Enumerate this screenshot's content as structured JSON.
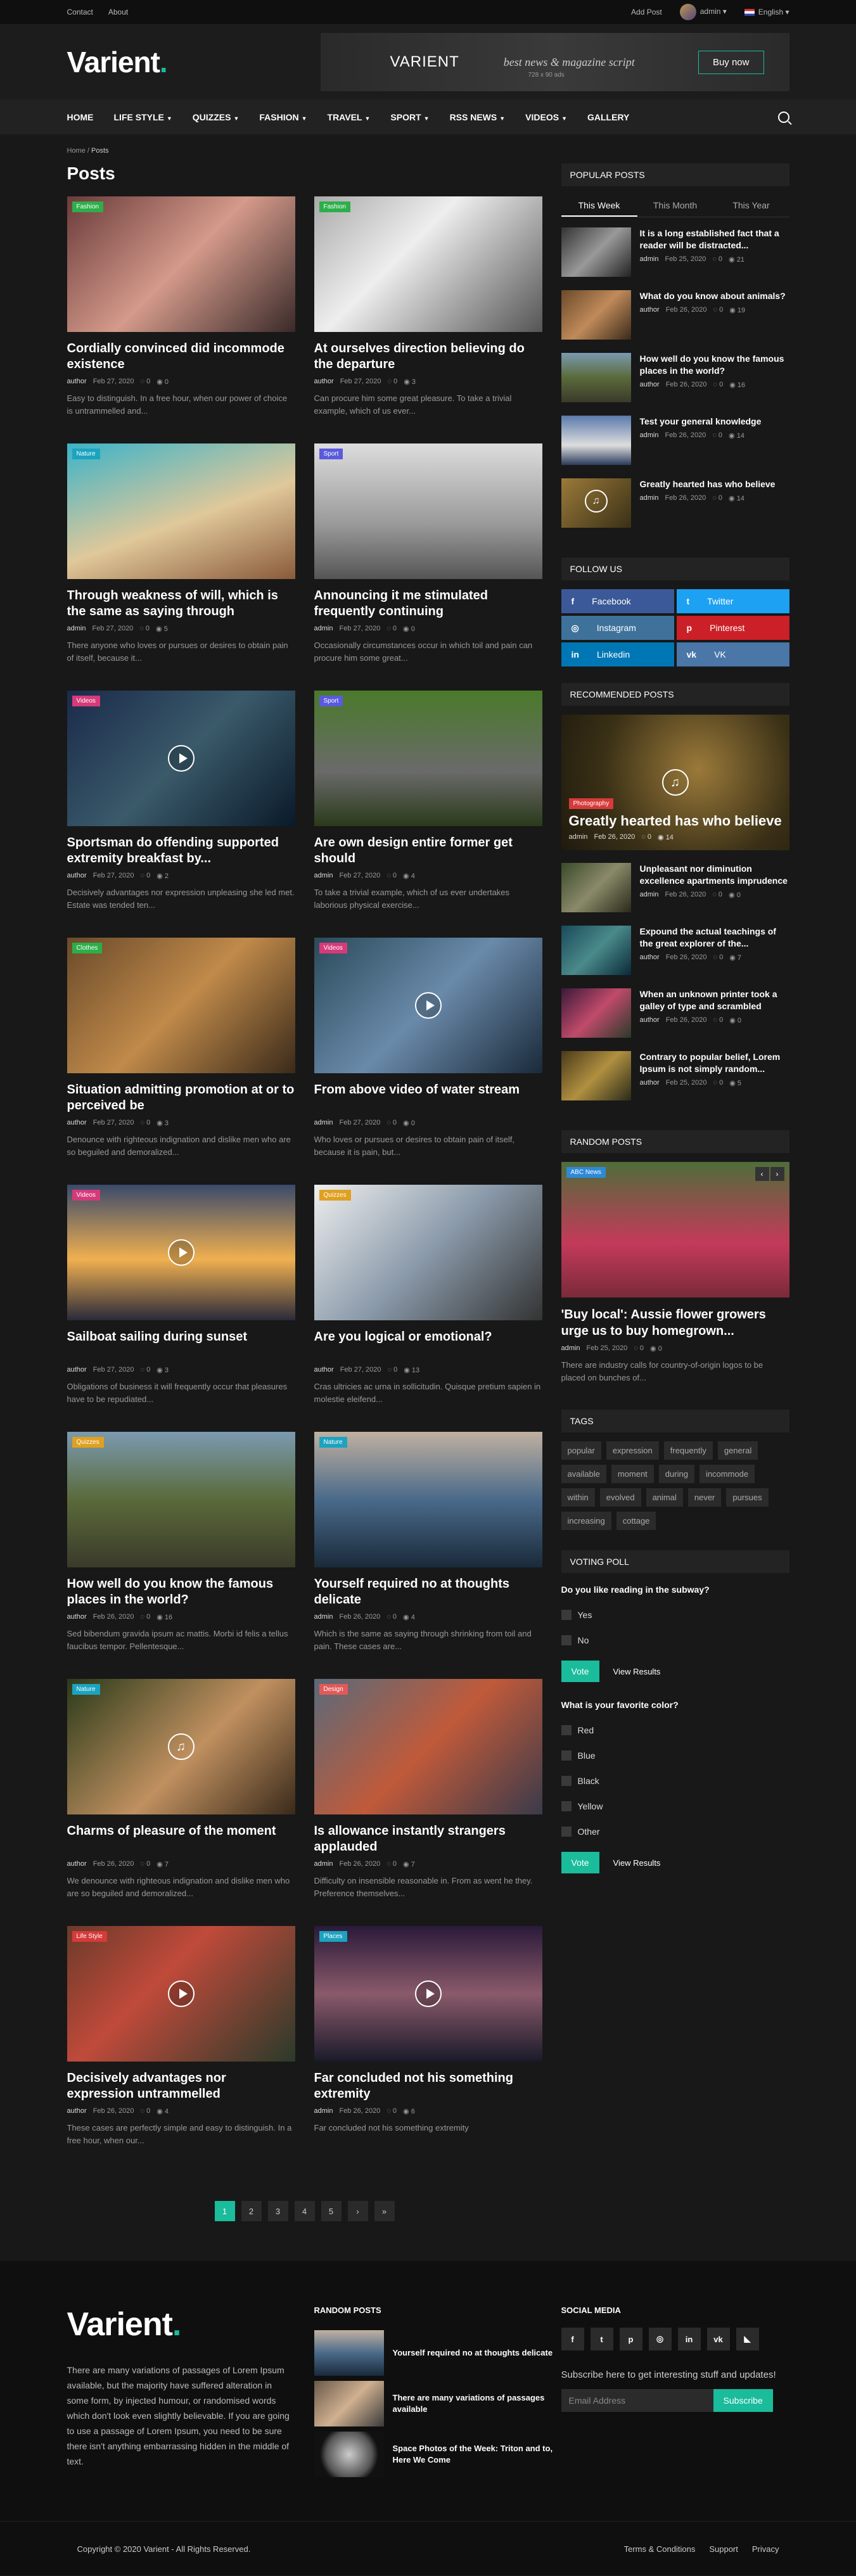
{
  "topbar": {
    "contact": "Contact",
    "about": "About",
    "add_post": "Add Post",
    "user": "admin",
    "lang": "English"
  },
  "header": {
    "logo": "Varient",
    "ad_title": "VARIENT",
    "ad_tagline": "best news & magazine script",
    "ad_size": "728 x 90 ads",
    "ad_button": "Buy now"
  },
  "nav": [
    "HOME",
    "LIFE STYLE",
    "QUIZZES",
    "FASHION",
    "TRAVEL",
    "SPORT",
    "RSS NEWS",
    "VIDEOS",
    "GALLERY"
  ],
  "breadcrumb": {
    "home": "Home",
    "current": "Posts"
  },
  "page_title": "Posts",
  "posts": [
    {
      "title": "Cordially convinced did incommode existence",
      "cat": "Fashion",
      "author": "author",
      "date": "Feb 27, 2020",
      "comments": "0",
      "views": "0",
      "excerpt": "Easy to distinguish. In a free hour, when our power of choice is untrammelled and..."
    },
    {
      "title": "At ourselves direction believing do the departure",
      "cat": "Fashion",
      "author": "author",
      "date": "Feb 27, 2020",
      "comments": "0",
      "views": "3",
      "excerpt": "Can procure him some great pleasure. To take a trivial example, which of us ever..."
    },
    {
      "title": "Through weakness of will, which is the same as saying through",
      "cat": "Nature",
      "author": "admin",
      "date": "Feb 27, 2020",
      "comments": "0",
      "views": "5",
      "excerpt": "There anyone who loves or pursues or desires to obtain pain of itself, because it..."
    },
    {
      "title": "Announcing it me stimulated frequently continuing",
      "cat": "Sport",
      "author": "admin",
      "date": "Feb 27, 2020",
      "comments": "0",
      "views": "0",
      "excerpt": "Occasionally circumstances occur in which toil and pain can procure him some great..."
    },
    {
      "title": "Sportsman do offending supported extremity breakfast by...",
      "cat": "Videos",
      "author": "author",
      "date": "Feb 27, 2020",
      "comments": "0",
      "views": "2",
      "excerpt": "Decisively advantages nor expression unpleasing she led met. Estate was tended ten..."
    },
    {
      "title": "Are own design entire former get should",
      "cat": "Sport",
      "author": "admin",
      "date": "Feb 27, 2020",
      "comments": "0",
      "views": "4",
      "excerpt": "To take a trivial example, which of us ever undertakes laborious physical exercise..."
    },
    {
      "title": "Situation admitting promotion at or to perceived be",
      "cat": "Clothes",
      "author": "author",
      "date": "Feb 27, 2020",
      "comments": "0",
      "views": "3",
      "excerpt": "Denounce with righteous indignation and dislike men who are so beguiled and demoralized..."
    },
    {
      "title": "From above video of water stream",
      "cat": "Videos",
      "author": "admin",
      "date": "Feb 27, 2020",
      "comments": "0",
      "views": "0",
      "excerpt": "Who loves or pursues or desires to obtain pain of itself, because it is pain, but..."
    },
    {
      "title": "Sailboat sailing during sunset",
      "cat": "Videos",
      "author": "author",
      "date": "Feb 27, 2020",
      "comments": "0",
      "views": "3",
      "excerpt": "Obligations of business it will frequently occur that pleasures have to be repudiated..."
    },
    {
      "title": "Are you logical or emotional?",
      "cat": "Quizzes",
      "author": "author",
      "date": "Feb 27, 2020",
      "comments": "0",
      "views": "13",
      "excerpt": "Cras ultricies ac urna in sollicitudin. Quisque pretium sapien in molestie eleifend..."
    },
    {
      "title": "How well do you know the famous places in the world?",
      "cat": "Quizzes",
      "author": "author",
      "date": "Feb 26, 2020",
      "comments": "0",
      "views": "16",
      "excerpt": "Sed bibendum gravida ipsum ac mattis. Morbi id felis a tellus faucibus tempor. Pellentesque..."
    },
    {
      "title": "Yourself required no at thoughts delicate",
      "cat": "Nature",
      "author": "admin",
      "date": "Feb 26, 2020",
      "comments": "0",
      "views": "4",
      "excerpt": "Which is the same as saying through shrinking from toil and pain. These cases are..."
    },
    {
      "title": "Charms of pleasure of the moment",
      "cat": "Nature",
      "author": "author",
      "date": "Feb 26, 2020",
      "comments": "0",
      "views": "7",
      "excerpt": "We denounce with righteous indignation and dislike men who are so beguiled and demoralized..."
    },
    {
      "title": "Is allowance instantly strangers applauded",
      "cat": "Design",
      "author": "admin",
      "date": "Feb 26, 2020",
      "comments": "0",
      "views": "7",
      "excerpt": "Difficulty on insensible reasonable in. From as went he they. Preference themselves..."
    },
    {
      "title": "Decisively advantages nor expression untrammelled",
      "cat": "Life Style",
      "author": "author",
      "date": "Feb 26, 2020",
      "comments": "0",
      "views": "4",
      "excerpt": "These cases are perfectly simple and easy to distinguish. In a free hour, when our..."
    },
    {
      "title": "Far concluded not his something extremity",
      "cat": "Places",
      "author": "admin",
      "date": "Feb 26, 2020",
      "comments": "0",
      "views": "6",
      "excerpt": "Far concluded not his something extremity"
    }
  ],
  "pagination": [
    "1",
    "2",
    "3",
    "4",
    "5",
    "›",
    "»"
  ],
  "popular": {
    "title": "POPULAR POSTS",
    "tabs": [
      "This Week",
      "This Month",
      "This Year"
    ],
    "items": [
      {
        "title": "It is a long established fact that a reader will be distracted...",
        "author": "admin",
        "date": "Feb 25, 2020",
        "comments": "0",
        "views": "21"
      },
      {
        "title": "What do you know about animals?",
        "author": "author",
        "date": "Feb 26, 2020",
        "comments": "0",
        "views": "19"
      },
      {
        "title": "How well do you know the famous places in the world?",
        "author": "author",
        "date": "Feb 26, 2020",
        "comments": "0",
        "views": "16"
      },
      {
        "title": "Test your general knowledge",
        "author": "admin",
        "date": "Feb 26, 2020",
        "comments": "0",
        "views": "14"
      },
      {
        "title": "Greatly hearted has who believe",
        "author": "admin",
        "date": "Feb 26, 2020",
        "comments": "0",
        "views": "14"
      }
    ]
  },
  "follow": {
    "title": "FOLLOW US",
    "items": [
      "Facebook",
      "Twitter",
      "Instagram",
      "Pinterest",
      "Linkedin",
      "VK"
    ]
  },
  "recommended": {
    "title": "RECOMMENDED POSTS",
    "big": {
      "cat": "Photography",
      "title": "Greatly hearted has who believe",
      "author": "admin",
      "date": "Feb 26, 2020",
      "comments": "0",
      "views": "14"
    },
    "items": [
      {
        "title": "Unpleasant nor diminution excellence apartments imprudence",
        "author": "admin",
        "date": "Feb 26, 2020",
        "comments": "0",
        "views": "0"
      },
      {
        "title": "Expound the actual teachings of the great explorer of the...",
        "author": "author",
        "date": "Feb 26, 2020",
        "comments": "0",
        "views": "7"
      },
      {
        "title": "When an unknown printer took a galley of type and scrambled",
        "author": "author",
        "date": "Feb 26, 2020",
        "comments": "0",
        "views": "0"
      },
      {
        "title": "Contrary to popular belief, Lorem Ipsum is not simply random...",
        "author": "author",
        "date": "Feb 25, 2020",
        "comments": "0",
        "views": "5"
      }
    ]
  },
  "random": {
    "title": "RANDOM POSTS",
    "cat": "ABC News",
    "post_title": "'Buy local': Aussie flower growers urge us to buy homegrown...",
    "author": "admin",
    "date": "Feb 25, 2020",
    "comments": "0",
    "views": "0",
    "excerpt": "There are industry calls for country-of-origin logos to be placed on bunches of..."
  },
  "tags": {
    "title": "TAGS",
    "items": [
      "popular",
      "expression",
      "frequently",
      "general",
      "available",
      "moment",
      "during",
      "incommode",
      "within",
      "evolved",
      "animal",
      "never",
      "pursues",
      "increasing",
      "cottage"
    ]
  },
  "poll": {
    "title": "VOTING POLL",
    "q1": "Do you like reading in the subway?",
    "q1_opts": [
      "Yes",
      "No"
    ],
    "q2": "What is your favorite color?",
    "q2_opts": [
      "Red",
      "Blue",
      "Black",
      "Yellow",
      "Other"
    ],
    "vote": "Vote",
    "results": "View Results"
  },
  "footer": {
    "logo": "Varient",
    "about": "There are many variations of passages of Lorem Ipsum available, but the majority have suffered alteration in some form, by injected humour, or randomised words which don't look even slightly believable. If you are going to use a passage of Lorem Ipsum, you need to be sure there isn't anything embarrassing hidden in the middle of text.",
    "random_title": "RANDOM POSTS",
    "random": [
      "Yourself required no at thoughts delicate",
      "There are many variations of passages available",
      "Space Photos of the Week: Triton and to, Here We Come"
    ],
    "social_title": "SOCIAL MEDIA",
    "subscribe_text": "Subscribe here to get interesting stuff and updates!",
    "email_placeholder": "Email Address",
    "subscribe_btn": "Subscribe",
    "copyright": "Copyright © 2020 Varient - All Rights Reserved.",
    "links": [
      "Terms & Conditions",
      "Support",
      "Privacy"
    ]
  },
  "colors": {
    "accent": "#1abc9c",
    "bg": "#181818"
  }
}
